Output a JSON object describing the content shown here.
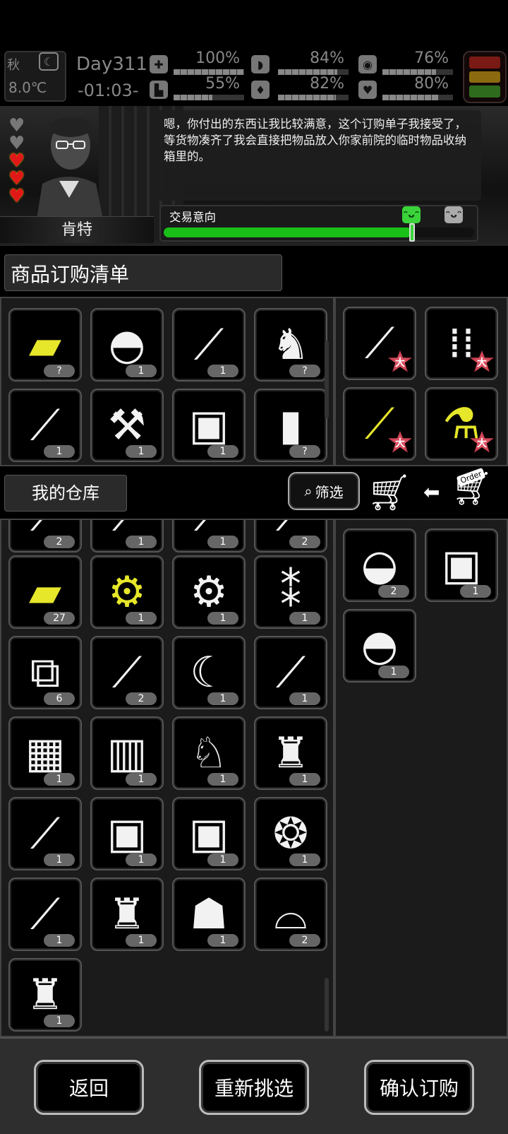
{
  "status": {
    "season": "秋",
    "temperature": "8.0℃",
    "day": "Day311",
    "time": "-01:03-",
    "stats": [
      {
        "name": "health",
        "icon": "medkit-icon",
        "value": "100%",
        "pct": 100
      },
      {
        "name": "hunger",
        "icon": "stomach-icon",
        "value": "84%",
        "pct": 84
      },
      {
        "name": "sanity",
        "icon": "brain-icon",
        "value": "76%",
        "pct": 76
      },
      {
        "name": "stamina",
        "icon": "boot-icon",
        "value": "55%",
        "pct": 55
      },
      {
        "name": "thirst",
        "icon": "water-drop-icon",
        "value": "82%",
        "pct": 82
      },
      {
        "name": "mood",
        "icon": "heart-icon",
        "value": "80%",
        "pct": 80
      }
    ],
    "colors": {
      "red": "#7a1a14",
      "yellow": "#8c6b10",
      "green": "#2f6b1d"
    }
  },
  "npc": {
    "name": "肯特",
    "hearts_total": 5,
    "hearts_filled": 3,
    "dialog": "嗯，你付出的东西让我比较满意，这个订购单子我接受了，等货物凑齐了我会直接把物品放入你家前院的临时物品收纳箱里的。",
    "trade_label": "交易意向",
    "trade_level": 0.8,
    "accent": "#18c018"
  },
  "order": {
    "title": "商品订购清单",
    "left_items": [
      {
        "icon": "tarp-icon",
        "count": "?",
        "yellow": true
      },
      {
        "icon": "iron-icon",
        "count": "1"
      },
      {
        "icon": "minigun-icon",
        "count": "1"
      },
      {
        "icon": "tool-bag-icon",
        "count": "?"
      },
      {
        "icon": "shovel-icon",
        "count": "1"
      },
      {
        "icon": "axe-icon",
        "count": "1"
      },
      {
        "icon": "backpack-icon",
        "count": "1"
      },
      {
        "icon": "bottle-icon",
        "count": "?"
      }
    ],
    "right_items": [
      {
        "icon": "rpg-rocket-icon",
        "badge": "大"
      },
      {
        "icon": "bullets-icon",
        "badge": "大"
      },
      {
        "icon": "rifle-parts-icon",
        "badge": "大",
        "yellow": true
      },
      {
        "icon": "flask-icon",
        "badge": "大",
        "yellow": true
      }
    ]
  },
  "warehouse": {
    "title": "我的仓库",
    "filter_label": "筛选",
    "order_tag": "Order",
    "partial_counts": [
      "2",
      "1",
      "1",
      "2"
    ],
    "left_items": [
      {
        "icon": "tarp-icon",
        "count": "27",
        "yellow": true
      },
      {
        "icon": "gun-parts-icon",
        "count": "1",
        "yellow": true
      },
      {
        "icon": "engine-parts-icon",
        "count": "1"
      },
      {
        "icon": "ampoules-icon",
        "count": "1"
      },
      {
        "icon": "toolbox-icon",
        "count": "6"
      },
      {
        "icon": "spark-plug-icon",
        "count": "2"
      },
      {
        "icon": "blade-icon",
        "count": "1"
      },
      {
        "icon": "chainsaw-icon",
        "count": "1"
      },
      {
        "icon": "engine-icon",
        "count": "1"
      },
      {
        "icon": "filter-icon",
        "count": "1"
      },
      {
        "icon": "rabbit-icon",
        "count": "1"
      },
      {
        "icon": "raincoat-icon",
        "count": "1"
      },
      {
        "icon": "grenade-launcher-icon",
        "count": "1"
      },
      {
        "icon": "hiking-backpack-icon",
        "count": "1"
      },
      {
        "icon": "backpack-icon",
        "count": "1"
      },
      {
        "icon": "tire-chain-icon",
        "count": "1"
      },
      {
        "icon": "assault-rifle-icon",
        "count": "1"
      },
      {
        "icon": "fur-coat-icon",
        "count": "1"
      },
      {
        "icon": "cloak-icon",
        "count": "1"
      },
      {
        "icon": "straw-hat-icon",
        "count": "2"
      },
      {
        "icon": "hoodie-icon",
        "count": "1"
      }
    ],
    "right_items": [
      {
        "icon": "helmet-icon",
        "count": "2"
      },
      {
        "icon": "hiking-backpack-icon",
        "count": "1"
      },
      {
        "icon": "tactical-helmet-icon",
        "count": "1"
      }
    ]
  },
  "buttons": {
    "back": "返回",
    "reselect": "重新挑选",
    "confirm": "确认订购"
  }
}
